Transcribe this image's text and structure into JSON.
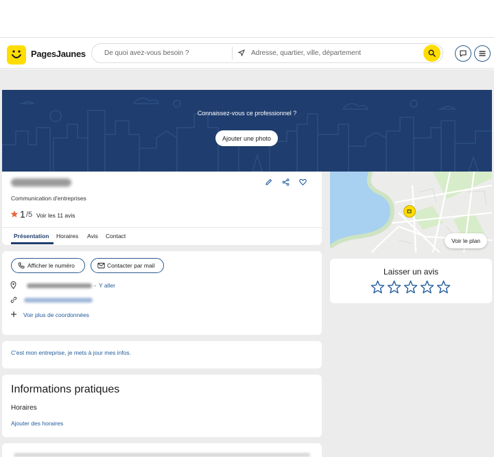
{
  "header": {
    "brand": "PagesJaunes",
    "search_what_placeholder": "De quoi avez-vous besoin ?",
    "search_where_placeholder": "Adresse, quartier, ville, département",
    "colors": {
      "accent": "#ffdd00",
      "navy": "#1f3d6e",
      "link": "#1f5a9a"
    }
  },
  "banner": {
    "question": "Connaissez-vous ce professionnel ?",
    "add_photo": "Ajouter une photo"
  },
  "business": {
    "category": "Communication d'entreprises",
    "rating": "1",
    "rating_max": "/5",
    "reviews_link": "Voir les 11 avis"
  },
  "tabs": [
    {
      "label": "Présentation",
      "active": true
    },
    {
      "label": "Horaires",
      "active": false
    },
    {
      "label": "Avis",
      "active": false
    },
    {
      "label": "Contact",
      "active": false
    }
  ],
  "contact": {
    "phone_button": "Afficher le numéro",
    "mail_button": "Contacter par mail",
    "directions_link": "Y aller",
    "directions_sep": "-",
    "more_info_link": "Voir plus de coordonnées"
  },
  "claim": {
    "link": "C'est mon entreprise, je mets à jour mes infos."
  },
  "info": {
    "title": "Informations pratiques",
    "hours_label": "Horaires",
    "add_hours_link": "Ajouter des horaires"
  },
  "map": {
    "view_map_button": "Voir le plan"
  },
  "review": {
    "title": "Laisser un avis",
    "stars": 5
  }
}
